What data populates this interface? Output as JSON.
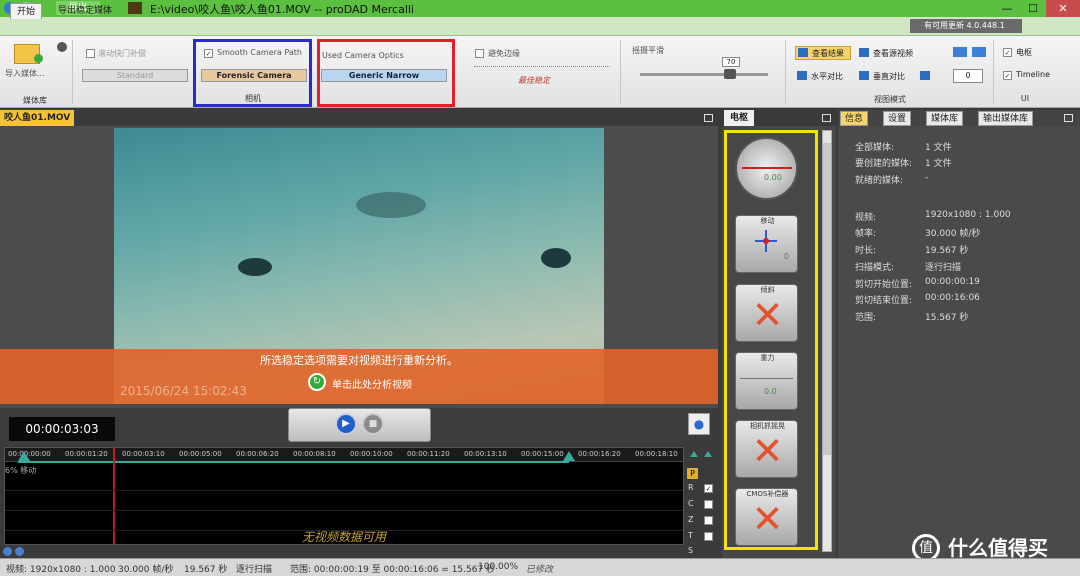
{
  "window": {
    "title": "E:\\video\\咬人鱼\\咬人鱼01.MOV -- proDAD Mercalli",
    "minimize": "—",
    "maximize": "☐",
    "close": "✕"
  },
  "tabs": {
    "export_btn": "导出",
    "start": "开始",
    "export_stabilized": "导出稳定媒体",
    "update": "有可用更新 4.0.448.1"
  },
  "ribbon": {
    "import_label": "导入媒体...",
    "media_group": "媒体库",
    "rolling_shutter": "滚动快门补偿",
    "standard": "Standard",
    "smooth_camera_path": "Smooth Camera Path",
    "forensic_camera": "Forensic Camera",
    "camera_group": "相机",
    "used_camera_optics": "Used Camera Optics",
    "generic_narrow": "Generic Narrow",
    "avoid_borders": "避免边缘",
    "max_stable": "最佳稳定",
    "pan_smoothing": "摇摄平滑",
    "pan_value": "70",
    "view_result": "查看结果",
    "view_source": "查看源视频",
    "h_compare": "水平对比",
    "v_compare": "垂直对比",
    "view_mode_group": "视图模式",
    "rotate_value": "0",
    "dashboard_cb": "电枢",
    "timeline_cb": "Timeline",
    "ui_group": "UI"
  },
  "video": {
    "tab_label": "咬人鱼01.MOV",
    "message": "所选稳定选项需要对视频进行重新分析。",
    "analyze_link": "单击此处分析视频",
    "timestamp_overlay": "2015/06/24 15:02:43",
    "timecode": "00:00:03:03",
    "play_icon": "▶",
    "stop_icon": "■",
    "loop_icon": "●"
  },
  "timeline": {
    "ticks": [
      "00:00:00:00",
      "00:00:01:20",
      "00:00:03:10",
      "00:00:05:00",
      "00:00:06:20",
      "00:00:08:10",
      "00:00:10:00",
      "00:00:11:20",
      "00:00:13:10",
      "00:00:15:00",
      "00:00:16:20",
      "00:00:18:10"
    ],
    "track_label": "6% 移动",
    "no_data": "无视频数据可用",
    "side_letters": [
      "P",
      "R",
      "C",
      "Z",
      "T",
      "S"
    ]
  },
  "dashboard": {
    "tab": "电枢",
    "gauges": [
      {
        "title": "",
        "value": "0.00",
        "type": "dial"
      },
      {
        "title": "移动",
        "value": "0",
        "type": "cross"
      },
      {
        "title": "倾斜",
        "value": "",
        "type": "x"
      },
      {
        "title": "重力",
        "value": "0.0",
        "type": "level"
      },
      {
        "title": "相机抓摇晃",
        "value": "",
        "type": "x"
      },
      {
        "title": "CMOS补偿器",
        "value": "",
        "type": "x"
      }
    ]
  },
  "info": {
    "tabs": [
      "信息",
      "设置",
      "媒体库",
      "输出媒体库"
    ],
    "rows": [
      {
        "k": "全部媒体:",
        "v": "1 文件"
      },
      {
        "k": "要创建的媒体:",
        "v": "1 文件"
      },
      {
        "k": "就绪的媒体:",
        "v": "-"
      },
      {
        "k": "视频:",
        "v": "1920x1080 : 1.000"
      },
      {
        "k": "帧率:",
        "v": "30.000 帧/秒"
      },
      {
        "k": "时长:",
        "v": "19.567 秒"
      },
      {
        "k": "扫描模式:",
        "v": "逐行扫描"
      },
      {
        "k": "剪切开始位置:",
        "v": "00:00:00:19"
      },
      {
        "k": "剪切结束位置:",
        "v": "00:00:16:06"
      },
      {
        "k": "范围:",
        "v": "15.567 秒"
      }
    ]
  },
  "status": {
    "video": "视频: 1920x1080 : 1.000",
    "fps": "30.000 帧/秒",
    "duration": "19.567 秒",
    "scan": "逐行扫描",
    "range": "范围: 00:00:00:19 至 00:00:16:06 = 15.567 秒",
    "zoom": "100.00%",
    "state": "已修改"
  },
  "brand": {
    "logo": "值",
    "text": "什么值得买"
  }
}
